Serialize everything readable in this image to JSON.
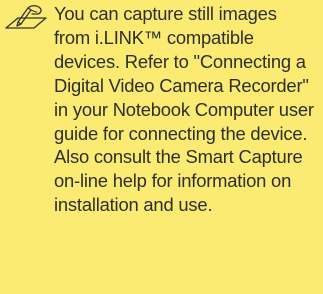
{
  "note": {
    "icon": "writing-hand-note-icon",
    "text": "You can capture still images from i.LINK™ compatible devices. Refer to \"Connecting a Digital Video Camera Recorder\" in your Notebook Computer user guide for connecting the device. Also consult the Smart Capture on-line help for information on installation and use.",
    "background_color": "#fbeb72"
  }
}
